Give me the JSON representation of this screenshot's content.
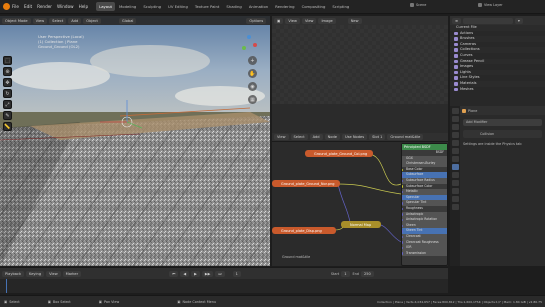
{
  "menu": [
    "File",
    "Edit",
    "Render",
    "Window",
    "Help"
  ],
  "workspaces": [
    {
      "label": "Layout",
      "active": true
    },
    {
      "label": "Modeling",
      "active": false
    },
    {
      "label": "Sculpting",
      "active": false
    },
    {
      "label": "UV Editing",
      "active": false
    },
    {
      "label": "Texture Paint",
      "active": false
    },
    {
      "label": "Shading",
      "active": false
    },
    {
      "label": "Animation",
      "active": false
    },
    {
      "label": "Rendering",
      "active": false
    },
    {
      "label": "Compositing",
      "active": false
    },
    {
      "label": "Scripting",
      "active": false
    }
  ],
  "scene": {
    "label": "Scene",
    "view_layer": "View Layer"
  },
  "viewport": {
    "mode": "Object Mode",
    "menus": [
      "View",
      "Select",
      "Add",
      "Object"
    ],
    "orientation": "Global",
    "options": "Options",
    "info": [
      "User Perspective (Local)",
      "(1) Collection | Plane",
      "Ground_Ground (OL2)"
    ]
  },
  "image_editor": {
    "menus": [
      "View",
      "View",
      "Image"
    ],
    "new": "New"
  },
  "node_editor": {
    "menus": [
      "View",
      "Select",
      "Add",
      "Node"
    ],
    "use_nodes": "Use Nodes",
    "slot": "Slot 1",
    "material": "Ground mat&tile",
    "label": "Ground mat&tile",
    "nodes": [
      {
        "label": "Ground_plate_Ground_Col.png",
        "color": "#c95a2c"
      },
      {
        "label": "Ground_plate_Ground_Nor.png",
        "color": "#c95a2c"
      },
      {
        "label": "Ground_plate_Disp.png",
        "color": "#c95a2c"
      },
      {
        "label": "Normal Map",
        "color": "#a88f2a"
      }
    ],
    "bsdf_title": "Principled BSDF",
    "bsdf_rows": [
      "BSDF",
      "GGX",
      "Christensen-Burley",
      "Base Color",
      "Subsurface",
      "Subsurface Radius",
      "Subsurface Color",
      "Metallic",
      "Specular",
      "Specular Tint",
      "Roughness",
      "Anisotropic",
      "Anisotropic Rotation",
      "Sheen",
      "Sheen Tint",
      "Clearcoat",
      "Clearcoat Roughness",
      "IOR",
      "Transmission"
    ]
  },
  "outliner": {
    "title": "Current File",
    "items": [
      "Actions",
      "Brushes",
      "Cameras",
      "Collections",
      "Curves",
      "Grease Pencil",
      "Images",
      "Lights",
      "Line Styles",
      "Materials",
      "Meshes"
    ]
  },
  "properties": {
    "object": "Plane",
    "modifier": "Add Modifier",
    "physics_note": "Settings are inside the Physics tab",
    "collision": "Collision"
  },
  "timeline": {
    "menus": [
      "Playback",
      "Keying",
      "View",
      "Marker"
    ],
    "start_label": "Start",
    "start": "1",
    "end_label": "End",
    "end": "250",
    "current": "1"
  },
  "status": {
    "left": [
      "Select",
      "Box Select",
      "Pan View",
      "Node Context Menu"
    ],
    "right": "Collection | Plane | Verts:4,034,657 | Faces:800,812 | Tris:1,600,1TSK | Objects:1/7 | Mem: 1.84 GiB | v2.80.75"
  }
}
